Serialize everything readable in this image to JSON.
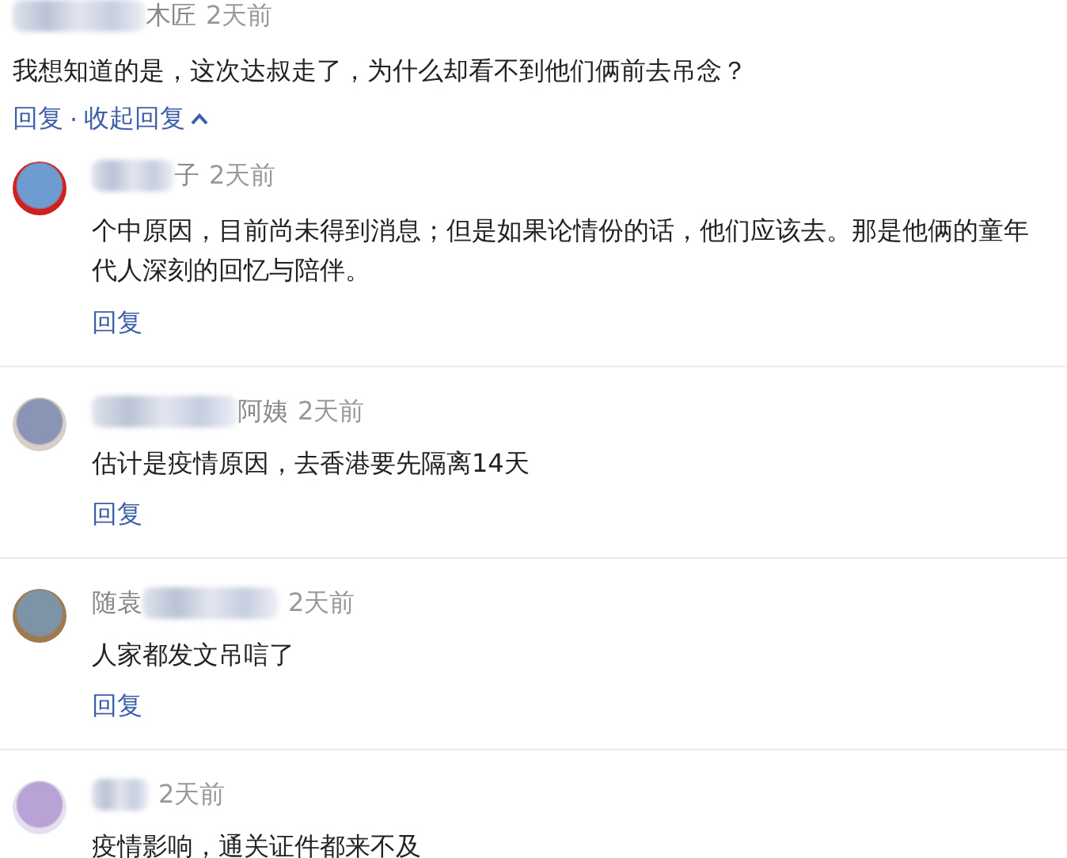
{
  "comment": {
    "name_parts": [
      {
        "kind": "mask"
      },
      {
        "kind": "text",
        "text": "木匠"
      }
    ],
    "time": "2天前",
    "text_lines": [
      "我想知道的是，这次达叔走了，为什么却看不到他们俩前去吊念？"
    ],
    "reply_label": "回复",
    "separator": "·",
    "collapse_label": "收起回复",
    "expanded": true
  },
  "replies": [
    {
      "name_parts": [
        {
          "kind": "mask"
        },
        {
          "kind": "text",
          "text": "子"
        }
      ],
      "time": "2天前",
      "text_lines": [
        "个中原因，目前尚未得到消息；但是如果论情份的话，他们应该去。那是他俩的童年",
        "代人深刻的回忆与陪伴。"
      ],
      "reply_label": "回复"
    },
    {
      "name_parts": [
        {
          "kind": "mask"
        },
        {
          "kind": "text",
          "text": "阿姨"
        }
      ],
      "time": "2天前",
      "text_lines": [
        "估计是疫情原因，去香港要先隔离14天"
      ],
      "reply_label": "回复"
    },
    {
      "name_parts": [
        {
          "kind": "text",
          "text": "随袁"
        },
        {
          "kind": "mask"
        }
      ],
      "time": "2天前",
      "text_lines": [
        "人家都发文吊唁了"
      ],
      "reply_label": "回复"
    },
    {
      "name_parts": [
        {
          "kind": "mask"
        }
      ],
      "time": "2天前",
      "text_lines": [
        "疫情影响，通关证件都来不及"
      ]
    }
  ]
}
